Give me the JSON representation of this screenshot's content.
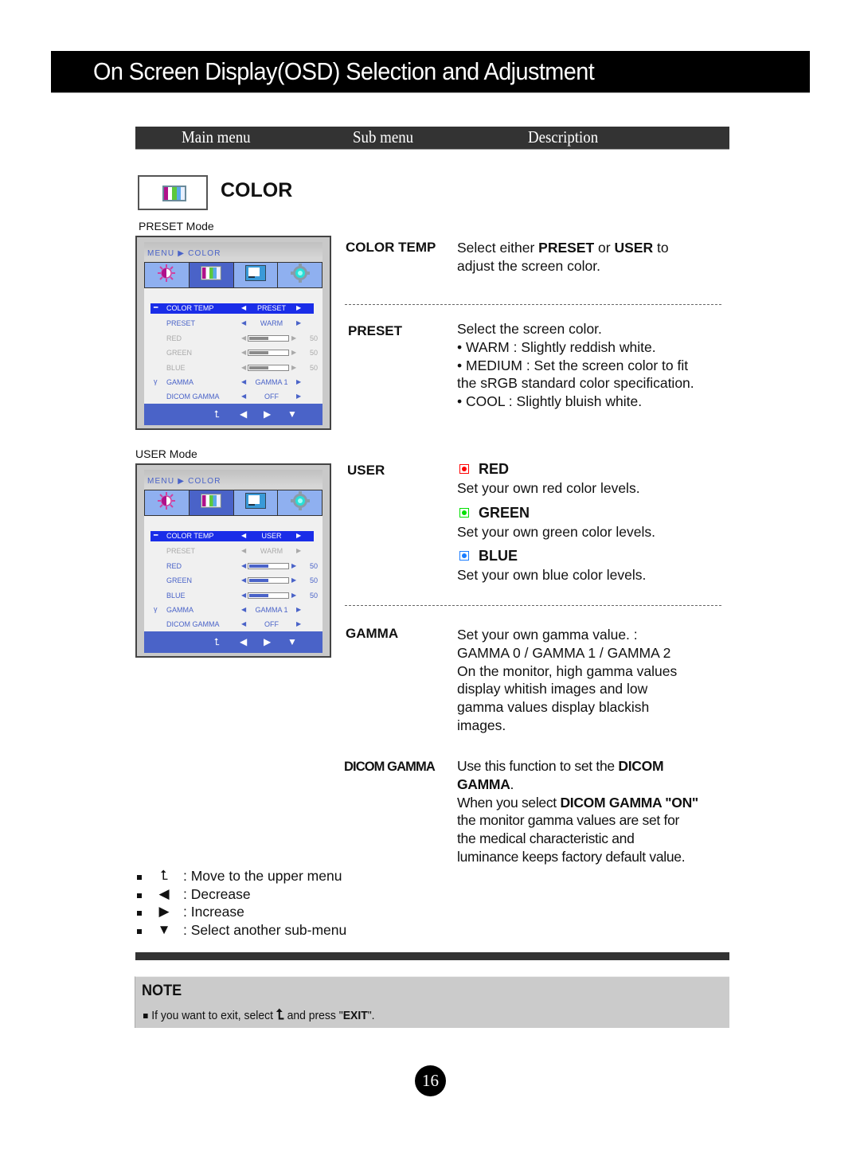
{
  "page_title": "On Screen Display(OSD) Selection and Adjustment",
  "header": {
    "main_menu": "Main menu",
    "sub_menu": "Sub menu",
    "description": "Description"
  },
  "section": {
    "title": "COLOR",
    "icon": "color-bars-icon"
  },
  "preset_panel": {
    "mode_label": "PRESET Mode",
    "breadcrumb": "MENU ▶ COLOR",
    "tabs": [
      "picture-brightness-icon",
      "color-bars-icon",
      "display-position-icon",
      "settings-gear-icon"
    ],
    "active_tab": 1,
    "rows": [
      {
        "label": "COLOR TEMP",
        "value": "PRESET",
        "state": "selected"
      },
      {
        "label": "PRESET",
        "value": "WARM",
        "state": "normal"
      },
      {
        "label": "RED",
        "value": 50,
        "state": "dim"
      },
      {
        "label": "GREEN",
        "value": 50,
        "state": "dim"
      },
      {
        "label": "BLUE",
        "value": 50,
        "state": "dim"
      },
      {
        "label": "GAMMA",
        "value": "GAMMA 1",
        "state": "normal"
      },
      {
        "label": "DICOM GAMMA",
        "value": "OFF",
        "state": "normal"
      }
    ],
    "footer_icons": [
      "up-menu-icon",
      "left-arrow-icon",
      "right-arrow-icon",
      "down-arrow-icon"
    ]
  },
  "user_panel": {
    "mode_label": "USER Mode",
    "breadcrumb": "MENU ▶ COLOR",
    "active_tab": 1,
    "rows": [
      {
        "label": "COLOR TEMP",
        "value": "USER",
        "state": "selected"
      },
      {
        "label": "PRESET",
        "value": "WARM",
        "state": "dim"
      },
      {
        "label": "RED",
        "value": 50,
        "state": "normal"
      },
      {
        "label": "GREEN",
        "value": 50,
        "state": "normal"
      },
      {
        "label": "BLUE",
        "value": 50,
        "state": "normal"
      },
      {
        "label": "GAMMA",
        "value": "GAMMA 1",
        "state": "normal"
      },
      {
        "label": "DICOM GAMMA",
        "value": "OFF",
        "state": "normal"
      }
    ]
  },
  "slider_max": 100,
  "descriptions": {
    "color_temp": {
      "term": "COLOR TEMP",
      "line1_a": "Select either ",
      "line1_b": "PRESET",
      "line1_c": " or ",
      "line1_d": "USER",
      "line1_e": " to",
      "line2": "adjust the screen color."
    },
    "preset": {
      "term": "PRESET",
      "lines": [
        "Select the screen color.",
        "• WARM : Slightly reddish white.",
        "• MEDIUM : Set the screen color to fit",
        "the sRGB standard color specification.",
        "• COOL : Slightly bluish white."
      ]
    },
    "user": {
      "term": "USER",
      "channels": [
        {
          "name": "RED",
          "text": "Set your own red color levels.",
          "color": "#ff0000"
        },
        {
          "name": "GREEN",
          "text": "Set your own green color levels.",
          "color": "#00e000"
        },
        {
          "name": "BLUE",
          "text": "Set your own blue color levels.",
          "color": "#1a7cff"
        }
      ]
    },
    "gamma": {
      "term": "GAMMA",
      "lines": [
        "Set your own gamma value. :",
        "GAMMA 0 / GAMMA 1 / GAMMA 2",
        "On the monitor, high gamma values",
        "display whitish images and low",
        "gamma values display blackish",
        "images."
      ]
    },
    "dicom_gamma": {
      "term": "DICOM GAMMA",
      "l1_a": "Use this function to set the ",
      "l1_b": "DICOM",
      "l2_b": "GAMMA",
      "l2_c": ".",
      "l3_a": "When you select ",
      "l3_b": "DICOM GAMMA \"ON\"",
      "l4": "the monitor gamma values are set for",
      "l5": "the medical characteristic and",
      "l6": "luminance keeps factory default value."
    }
  },
  "legend": [
    {
      "icon": "up-menu-icon",
      "glyph": "⮤",
      "text": ": Move to the upper menu"
    },
    {
      "icon": "left-arrow-icon",
      "glyph": "◀",
      "text": ": Decrease"
    },
    {
      "icon": "right-arrow-icon",
      "glyph": "▶",
      "text": ": Increase"
    },
    {
      "icon": "down-arrow-icon",
      "glyph": "▼",
      "text": ": Select another sub-menu"
    }
  ],
  "note": {
    "title": "NOTE",
    "text_a": "If you want to exit, select ",
    "text_b": " and press \"",
    "text_c": "EXIT",
    "text_d": "\"."
  },
  "page_number": "16",
  "colors": {
    "osd_blue": "#4a63c8",
    "osd_select": "#1a2de8",
    "osd_tab": "#8fb0f0"
  }
}
